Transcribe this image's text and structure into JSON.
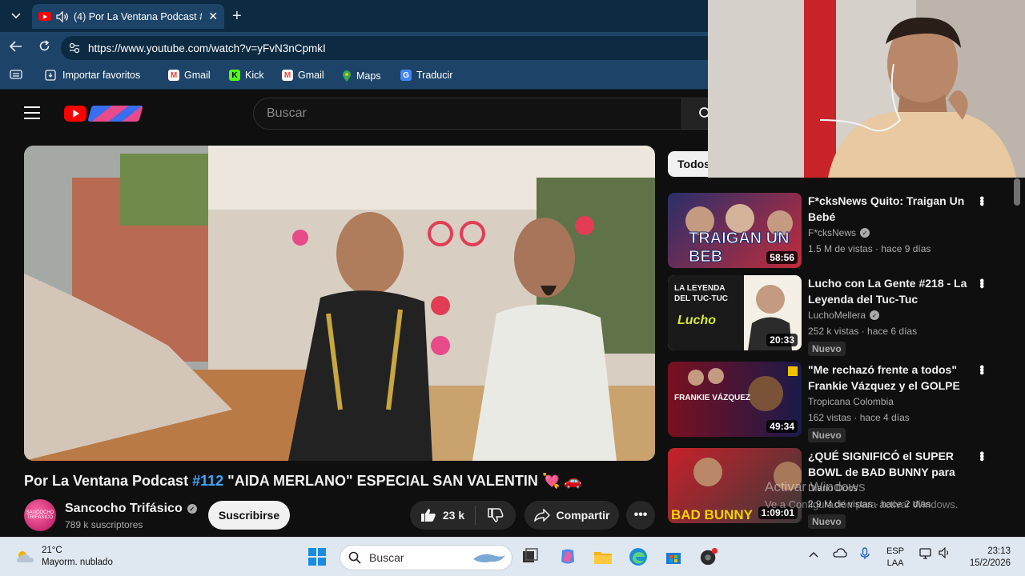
{
  "browser": {
    "tab_title": "(4) Por La Ventana Podcast #1",
    "url": "https://www.youtube.com/watch?v=yFvN3nCpmkI",
    "bookmarks": [
      {
        "label": "Importar favoritos"
      },
      {
        "label": "Gmail"
      },
      {
        "label": "Kick"
      },
      {
        "label": "Gmail"
      },
      {
        "label": "Maps"
      },
      {
        "label": "Traducir"
      }
    ]
  },
  "youtube": {
    "search_placeholder": "Buscar",
    "video": {
      "title_prefix": "Por La Ventana Podcast",
      "hashtag": "#112",
      "title_rest": "\"AIDA MERLANO\" ESPECIAL SAN VALENTIN",
      "title_emoji": "💘 🚗",
      "channel": "Sancocho Trifásico",
      "subscribers": "789 k suscriptores",
      "subscribe_label": "Suscribirse",
      "likes": "23 k",
      "share_label": "Compartir",
      "avatar_text": "SANCOCHO TRIFÁSICO"
    },
    "filter_chip": "Todos",
    "recommendations": [
      {
        "title": "F*cksNews Quito: Traigan Un Bebé",
        "channel": "F*cksNews",
        "verified": true,
        "meta": "1.5 M de vistas · hace 9 días",
        "duration": "58:56",
        "badge": "",
        "thumb_text": "TRAIGAN UN BEB"
      },
      {
        "title": "Lucho con La Gente #218 - La Leyenda del Tuc-Tuc",
        "channel": "LuchoMellera",
        "verified": true,
        "meta": "252 k vistas · hace 6 días",
        "duration": "20:33",
        "badge": "Nuevo",
        "thumb_text": "LA LEYENDA DEL TUC-TUC"
      },
      {
        "title": "\"Me rechazó frente a todos\" Frankie Vázquez y el GOLPE ...",
        "channel": "Tropicana Colombia",
        "verified": false,
        "meta": "162 vistas · hace 4 días",
        "duration": "49:34",
        "badge": "Nuevo",
        "thumb_text": "FRANKIE VÁZQUEZ"
      },
      {
        "title": "¿QUÉ SIGNIFICÓ el SUPER BOWL de BAD BUNNY para los...",
        "channel": "Diario Docs",
        "verified": false,
        "meta": "2.9 M de vistas · hace 2 días",
        "duration": "1:09:01",
        "badge": "Nuevo",
        "thumb_text": "BAD BUNNY"
      }
    ],
    "watermark_line1": "Activar Windows",
    "watermark_line2": "Ve a Configuración para activar Windows."
  },
  "taskbar": {
    "temperature": "21°C",
    "weather": "Mayorm. nublado",
    "search_placeholder": "Buscar",
    "lang_line1": "ESP",
    "lang_line2": "LAA",
    "time": "23:13",
    "date": "15/2/2026"
  },
  "colors": {
    "chrome_dark": "#0c2a42",
    "chrome_light": "#1d4468",
    "yt_bg": "#0f0f0f",
    "yt_red": "#ff0000",
    "link_blue": "#3ea6ff"
  }
}
